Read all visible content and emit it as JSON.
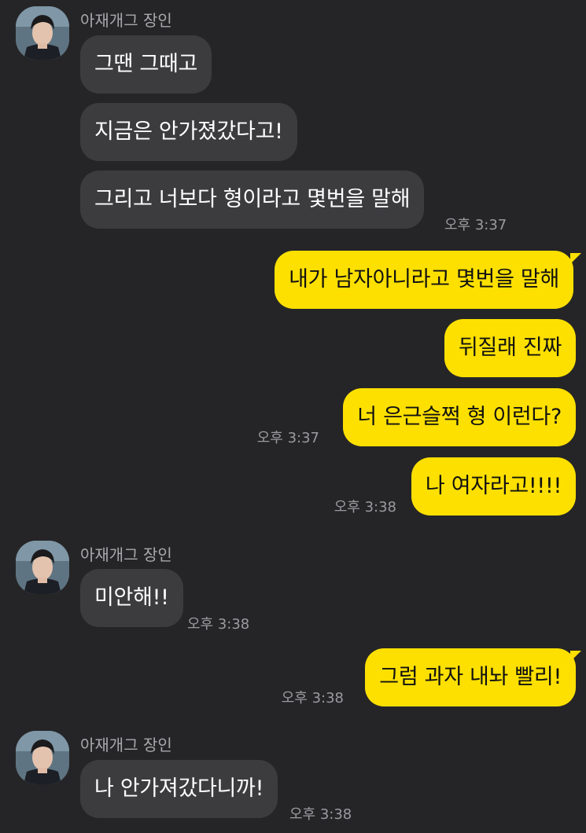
{
  "colors": {
    "background": "#252527",
    "incoming_bubble": "#3c3c3f",
    "outgoing_bubble": "#fde000",
    "sender_text": "#a9a9ad",
    "time_text": "#9b9b9f"
  },
  "groups": [
    {
      "sender": "아재개그 장인",
      "avatar_icon": "profile-photo-icon",
      "messages": [
        "그땐 그때고",
        "지금은 안가졌갔다고!",
        "그리고 너보다 형이라고 몇번을 말해"
      ],
      "time": "오후 3:37"
    },
    {
      "outgoing": true,
      "messages": [
        "내가 남자아니라고 몇번을 말해",
        "뒤질래 진짜",
        "너 은근슬쩍 형 이런다?"
      ],
      "time": "오후 3:37"
    },
    {
      "outgoing": true,
      "messages": [
        "나 여자라고!!!!"
      ],
      "time": "오후 3:38"
    },
    {
      "sender": "아재개그 장인",
      "avatar_icon": "profile-photo-icon",
      "messages": [
        "미안해!!"
      ],
      "time": "오후 3:38"
    },
    {
      "outgoing": true,
      "messages": [
        "그럼 과자 내놔 빨리!"
      ],
      "time": "오후 3:38"
    },
    {
      "sender": "아재개그 장인",
      "avatar_icon": "profile-photo-icon",
      "messages": [
        "나 안가져갔다니까!"
      ],
      "time": "오후 3:38"
    }
  ]
}
